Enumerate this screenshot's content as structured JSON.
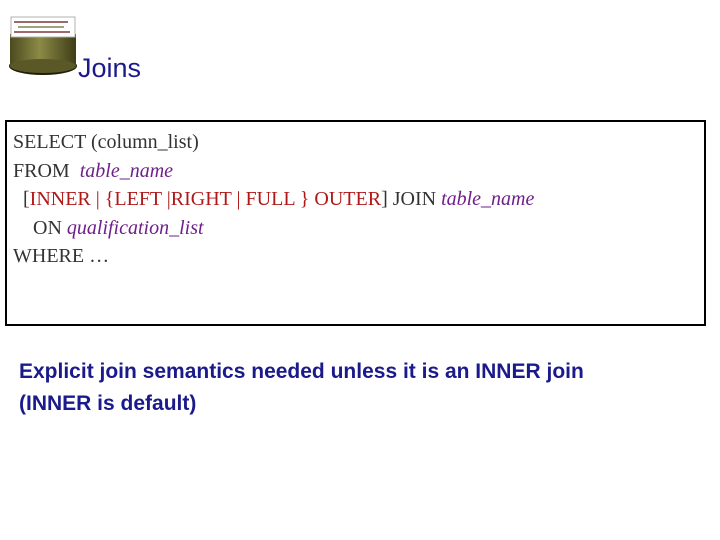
{
  "slide": {
    "title": "Joins",
    "logo_icon": "database-cylinder-icon"
  },
  "syntax": {
    "line1": "SELECT (column_list)",
    "line2_kw": "FROM  ",
    "line2_table": "table_name",
    "line3_prefix": "  [",
    "line3_inner": "INNER | {LEFT |RIGHT | FULL } OUTER",
    "line3_suffix": "] JOIN ",
    "line3_table": "table_name",
    "line4_kw": "    ON ",
    "line4_qual": "qualification_list",
    "line5": "WHERE …"
  },
  "note": {
    "line1": "Explicit join semantics needed unless it is an INNER join",
    "line2": "(INNER is default)"
  },
  "colors": {
    "title": "#1a1a8c",
    "italic": "#6e1f8a",
    "bracketed": "#b01818",
    "note": "#1a1a8c"
  }
}
